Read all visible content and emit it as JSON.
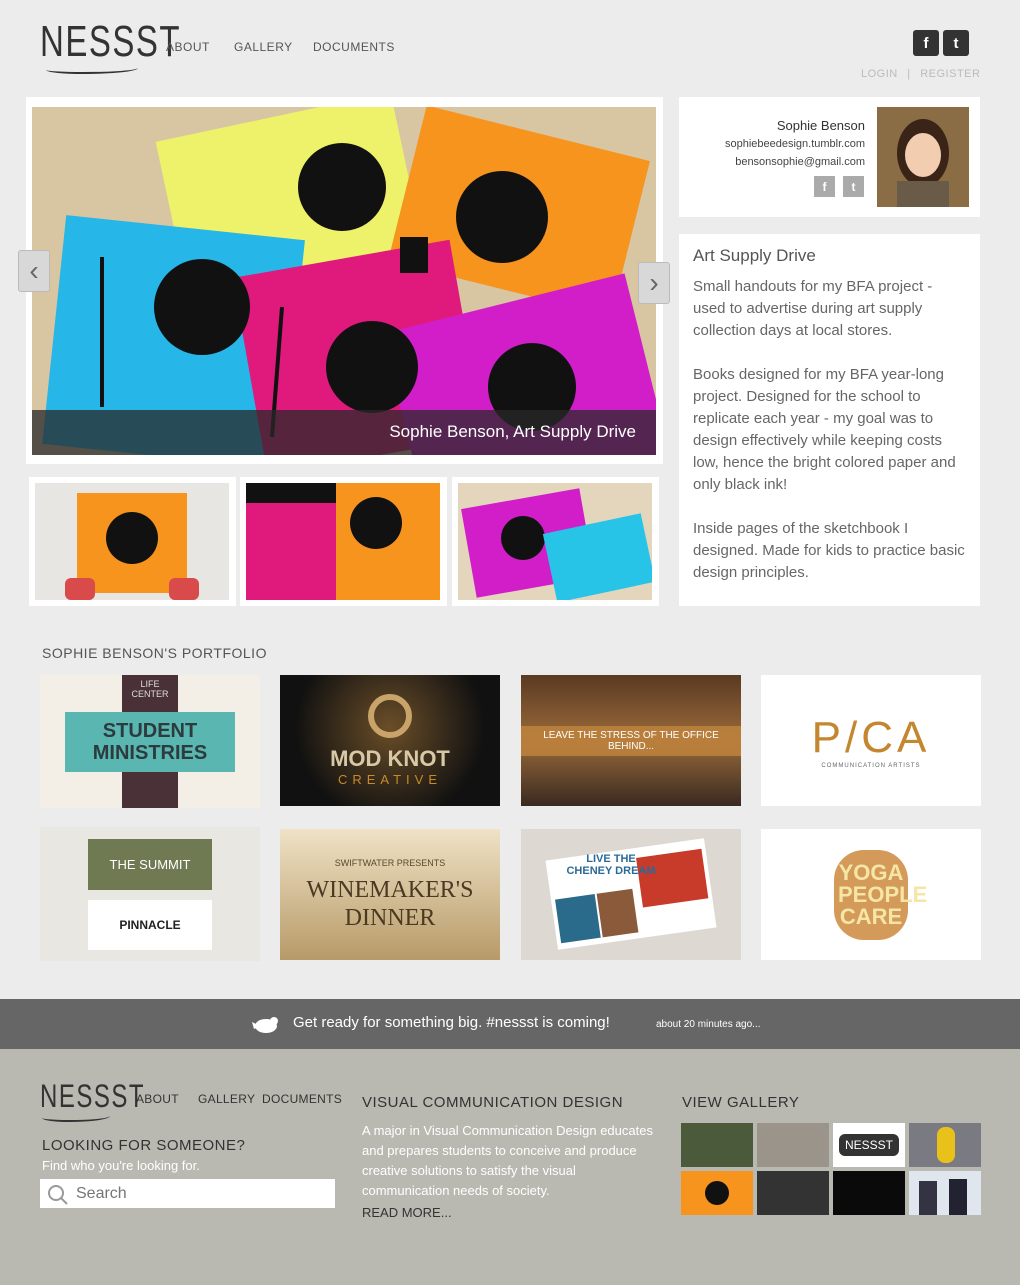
{
  "header": {
    "logo": "NESSST",
    "nav": [
      "ABOUT",
      "GALLERY",
      "DOCUMENTS"
    ],
    "social": {
      "facebook": "f",
      "twitter": "t"
    },
    "login": "LOGIN",
    "separator": "|",
    "register": "REGISTER"
  },
  "slideshow": {
    "caption": "Sophie Benson, Art Supply Drive",
    "prev": "‹",
    "next": "›"
  },
  "profile": {
    "name": "Sophie Benson",
    "website": "sophiebeedesign.tumblr.com",
    "email": "bensonsophie@gmail.com",
    "social": {
      "facebook": "f",
      "twitter": "t"
    }
  },
  "description": {
    "title": "Art Supply Drive",
    "paragraphs": [
      "Small handouts for my BFA project - used to advertise during art supply collection days at local stores.",
      "Books designed for my BFA year-long project. Designed for the school to replicate each year - my goal was to design effectively while keeping costs low, hence the bright colored paper and only black ink!",
      "Inside pages of the sketchbook I designed. Made for kids to practice basic design principles."
    ]
  },
  "portfolio": {
    "title": "SOPHIE BENSON'S PORTFOLIO",
    "tiles": [
      {
        "text": "STUDENT MINISTRIES",
        "sub": "LIFE CENTER"
      },
      {
        "text": "MOD KNOT",
        "sub": "CREATIVE"
      },
      {
        "text": "LEAVE THE STRESS OF THE OFFICE BEHIND...",
        "sub": ""
      },
      {
        "text": "P/CA",
        "sub": "COMMUNICATION ARTISTS"
      },
      {
        "text": "THE SUMMIT",
        "sub": "PINNACLE"
      },
      {
        "text": "WINEMAKER'S DINNER",
        "sub": "SWIFTWATER PRESENTS"
      },
      {
        "text": "LIVE THE CHENEY DREAM",
        "sub": ""
      },
      {
        "text": "YOGA PEOPLE CARE",
        "sub": ""
      }
    ]
  },
  "tweet": {
    "text": "Get ready for something big. #nessst is coming!",
    "time": "about 20 minutes ago..."
  },
  "footer": {
    "logo": "NESSST",
    "nav": [
      "ABOUT",
      "GALLERY",
      "DOCUMENTS"
    ],
    "search_title": "LOOKING FOR SOMEONE?",
    "search_sub": "Find who you're looking for.",
    "search_placeholder": "Search",
    "vcd_title": "VISUAL COMMUNICATION DESIGN",
    "vcd_body": "A major in Visual Communication Design educates and prepares students to conceive and produce creative solutions to satisfy the visual communication needs of society.",
    "read_more": "READ MORE...",
    "gallery_title": "VIEW GALLERY",
    "gallery_logo": "NESSST"
  },
  "colors": {
    "orange": "#f7941d",
    "magenta": "#e0197d",
    "cyan": "#27b6e8",
    "yellow": "#eef26a"
  }
}
